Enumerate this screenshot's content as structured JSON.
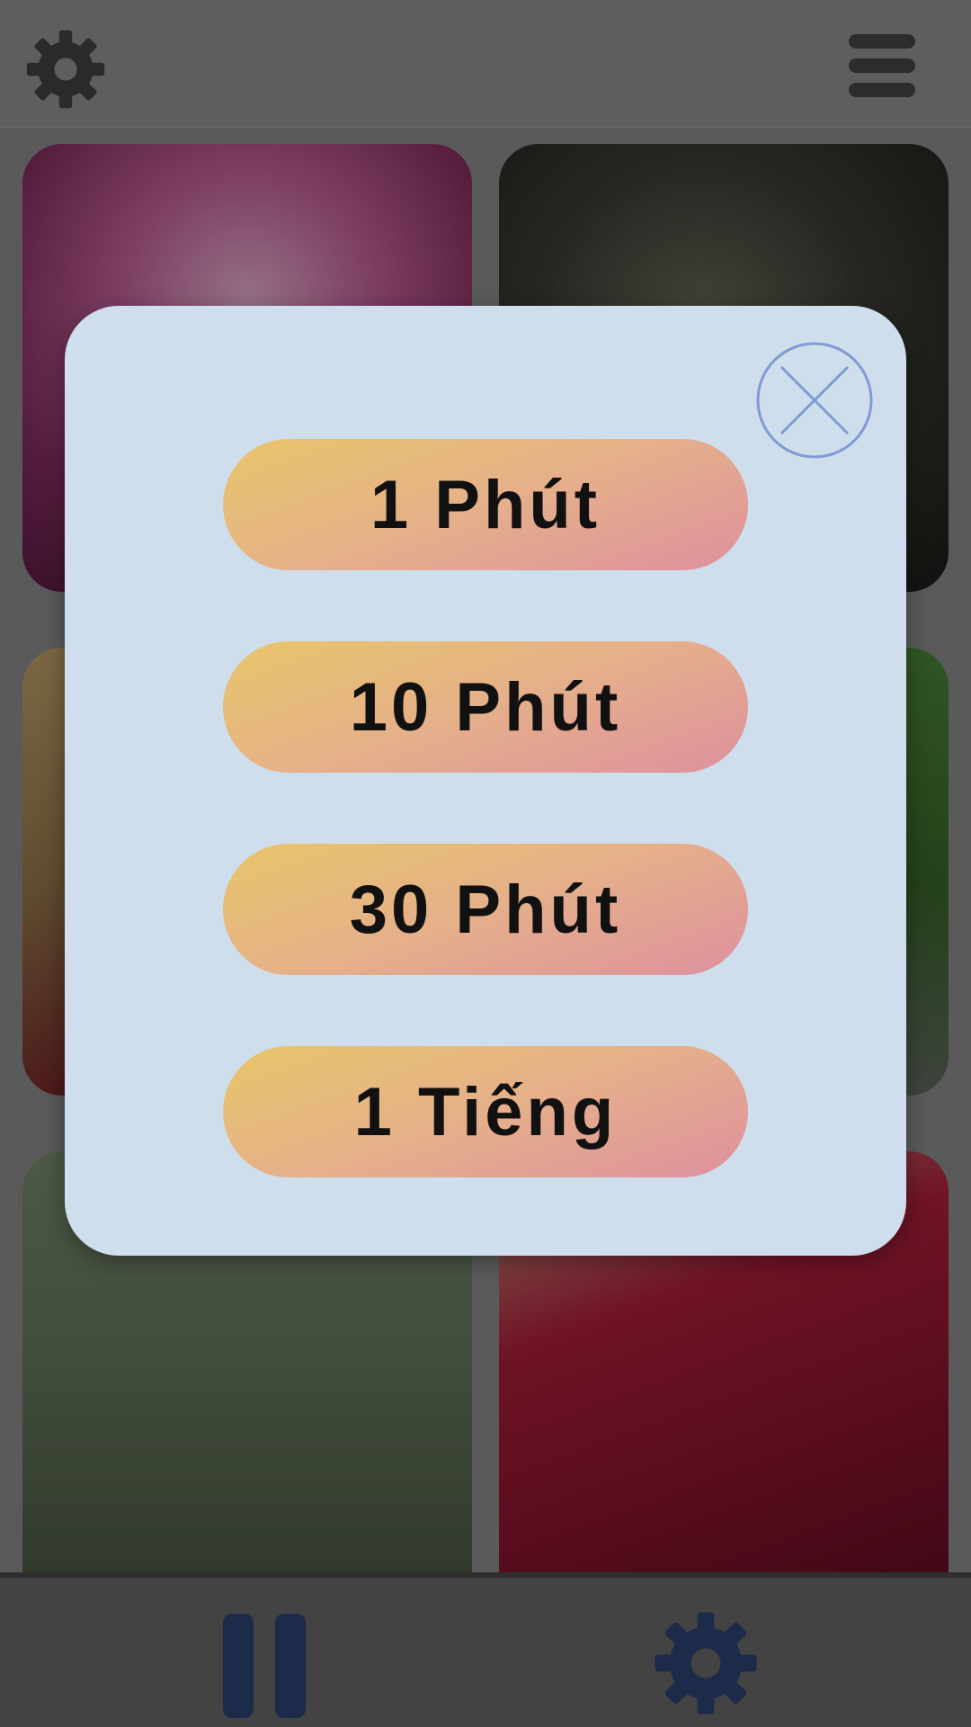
{
  "header": {
    "settings_icon": "gear-icon",
    "menu_icon": "hamburger-menu-icon"
  },
  "gallery": {
    "tiles": [
      {
        "name": "pink-mandala-tile"
      },
      {
        "name": "buddha-face-tile"
      },
      {
        "name": "meditating-monk-tile"
      },
      {
        "name": "green-nature-tile"
      },
      {
        "name": "stone-buddha-statue-tile"
      },
      {
        "name": "folded-hands-tile"
      }
    ]
  },
  "modal": {
    "close_icon": "close-icon",
    "options": [
      {
        "label": "1 Phút"
      },
      {
        "label": "10 Phút"
      },
      {
        "label": "30 Phút"
      },
      {
        "label": "1 Tiếng"
      }
    ]
  },
  "footer": {
    "pause_icon": "pause-icon",
    "settings_icon": "gear-icon"
  },
  "colors": {
    "modal_background": "#cfdeec",
    "option_gradient_start": "#e8c56a",
    "option_gradient_end": "#de909e",
    "close_icon_color": "#7f9bd1",
    "footer_icon_color": "#1d2b4a"
  }
}
